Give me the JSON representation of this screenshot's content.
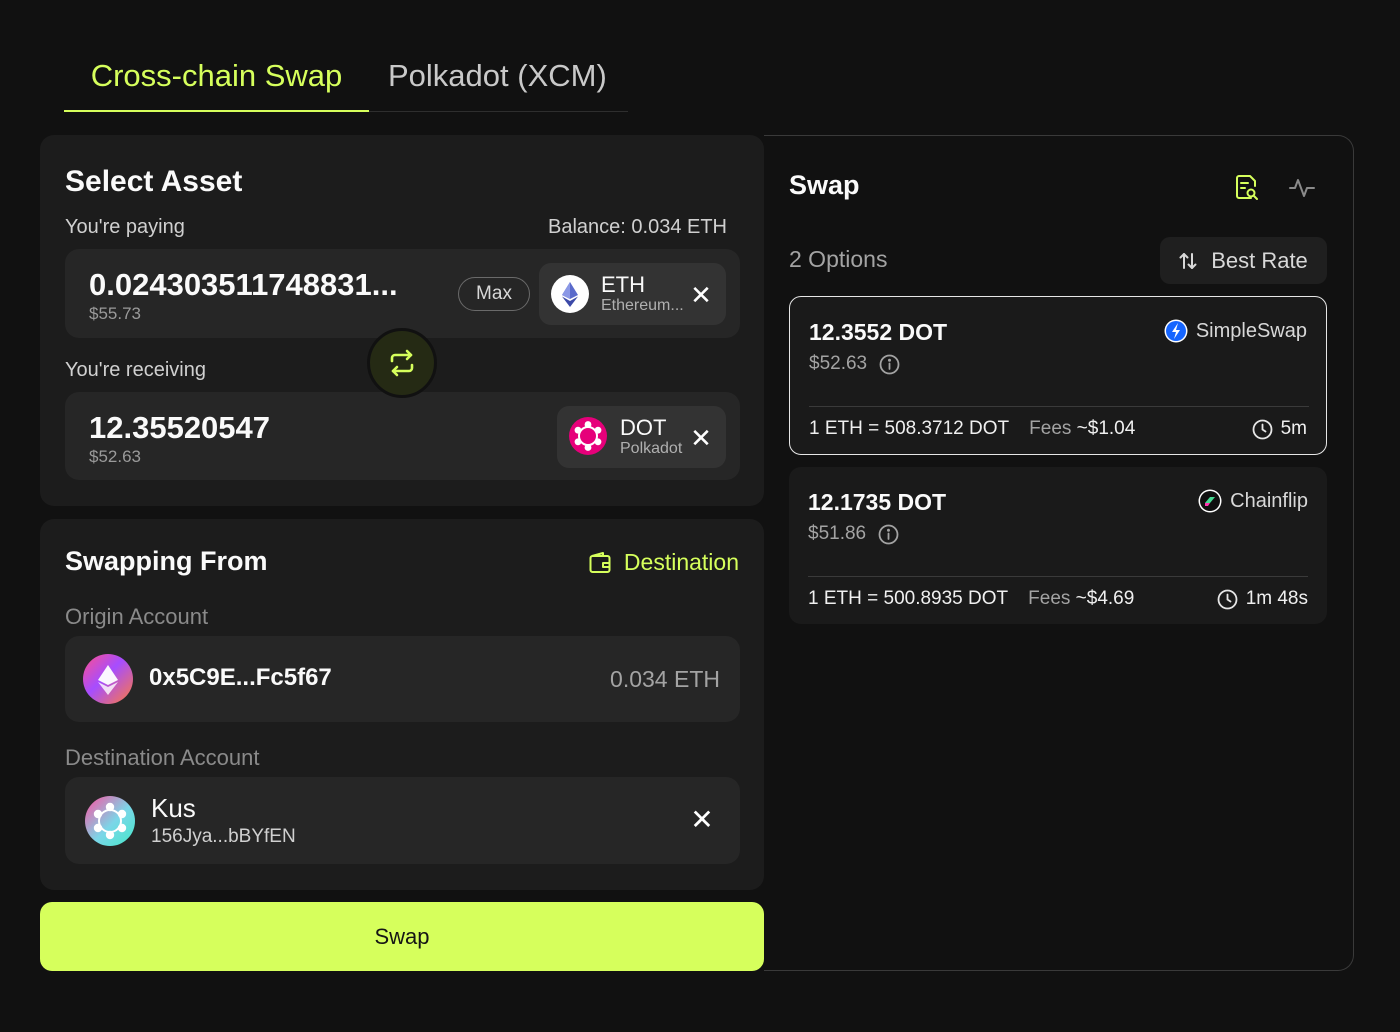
{
  "tabs": [
    {
      "label": "Cross-chain Swap",
      "active": true
    },
    {
      "label": "Polkadot (XCM)",
      "active": false
    }
  ],
  "select_asset": {
    "title": "Select Asset",
    "paying_label": "You're paying",
    "balance": "Balance: 0.034 ETH",
    "paying_amount": "0.024303511748831...",
    "paying_usd": "$55.73",
    "max_label": "Max",
    "paying_asset": {
      "symbol": "ETH",
      "name": "Ethereum..."
    },
    "receiving_label": "You're receiving",
    "receiving_amount": "12.35520547",
    "receiving_usd": "$52.63",
    "receiving_asset": {
      "symbol": "DOT",
      "name": "Polkadot"
    }
  },
  "swapping_from": {
    "title": "Swapping From",
    "destination_link": "Destination",
    "origin_label": "Origin Account",
    "origin_address": "0x5C9E...Fc5f67",
    "origin_balance": "0.034 ETH",
    "destination_label": "Destination Account",
    "destination_name": "Kus",
    "destination_address": "156Jya...bBYfEN"
  },
  "swap_button": "Swap",
  "swap_panel": {
    "title": "Swap",
    "options_count": "2 Options",
    "sort_label": "Best Rate",
    "options": [
      {
        "amount": "12.3552 DOT",
        "usd": "$52.63",
        "provider": "SimpleSwap",
        "rate": "1 ETH = 508.3712 DOT",
        "fees_label": "Fees",
        "fees_value": "~$1.04",
        "time": "5m",
        "selected": true
      },
      {
        "amount": "12.1735 DOT",
        "usd": "$51.86",
        "provider": "Chainflip",
        "rate": "1 ETH = 500.8935 DOT",
        "fees_label": "Fees",
        "fees_value": "~$4.69",
        "time": "1m 48s",
        "selected": false
      }
    ]
  },
  "colors": {
    "accent": "#d6ff5c",
    "background": "#111111",
    "panel": "#1c1c1c",
    "field": "#262626"
  },
  "icons": [
    "swap-arrows-icon",
    "ethereum-icon",
    "polkadot-icon",
    "close-icon",
    "wallet-icon",
    "report-search-icon",
    "activity-icon",
    "sort-arrows-icon",
    "simpleswap-icon",
    "chainflip-icon",
    "info-icon",
    "clock-icon"
  ]
}
